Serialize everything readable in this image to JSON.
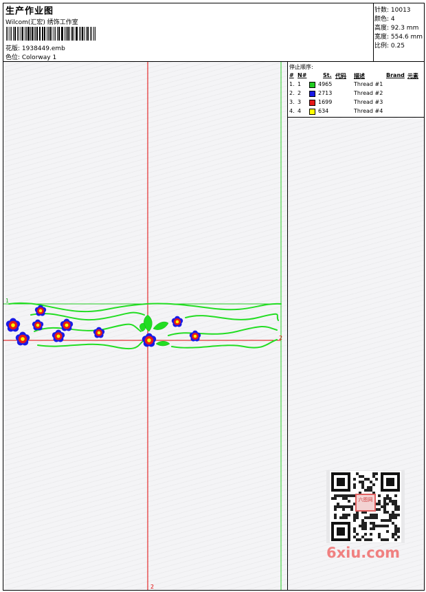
{
  "header": {
    "title": "生产作业图",
    "company": "Wilcom(汇宏) 绣饰工作室",
    "design_file": "花版: 1938449.emb",
    "colorway": "色位: Colorway 1"
  },
  "stats": [
    {
      "label": "针数: ",
      "value": "10013"
    },
    {
      "label": "颜色: ",
      "value": "4"
    },
    {
      "label": "高度: ",
      "value": "92.3 mm"
    },
    {
      "label": "宽度: ",
      "value": "554.6 mm"
    },
    {
      "label": "比例: ",
      "value": "0.25"
    }
  ],
  "threads": {
    "title": "停止顺序:",
    "columns": {
      "num": "#",
      "n": "N#",
      "st": "St.",
      "code": "代码",
      "desc": "描述",
      "brand": "Brand",
      "element": "元素"
    },
    "rows": [
      {
        "num": "1.",
        "n": "1",
        "color": "#22cc22",
        "stitches": "4965",
        "desc": "Thread #1"
      },
      {
        "num": "2.",
        "n": "2",
        "color": "#1a1ae6",
        "stitches": "2713",
        "desc": "Thread #2"
      },
      {
        "num": "3.",
        "n": "3",
        "color": "#e61a1a",
        "stitches": "1699",
        "desc": "Thread #3"
      },
      {
        "num": "4.",
        "n": "4",
        "color": "#ffff00",
        "stitches": "634",
        "desc": "Thread #4"
      }
    ]
  },
  "canvas": {
    "marker_1": "1",
    "marker_2_right": "2",
    "marker_2_bottom": "2",
    "guide_red": "#e00000",
    "guide_green": "#22cc22"
  },
  "watermark": {
    "seal_text": "六图网",
    "site": "6xiu.com"
  }
}
